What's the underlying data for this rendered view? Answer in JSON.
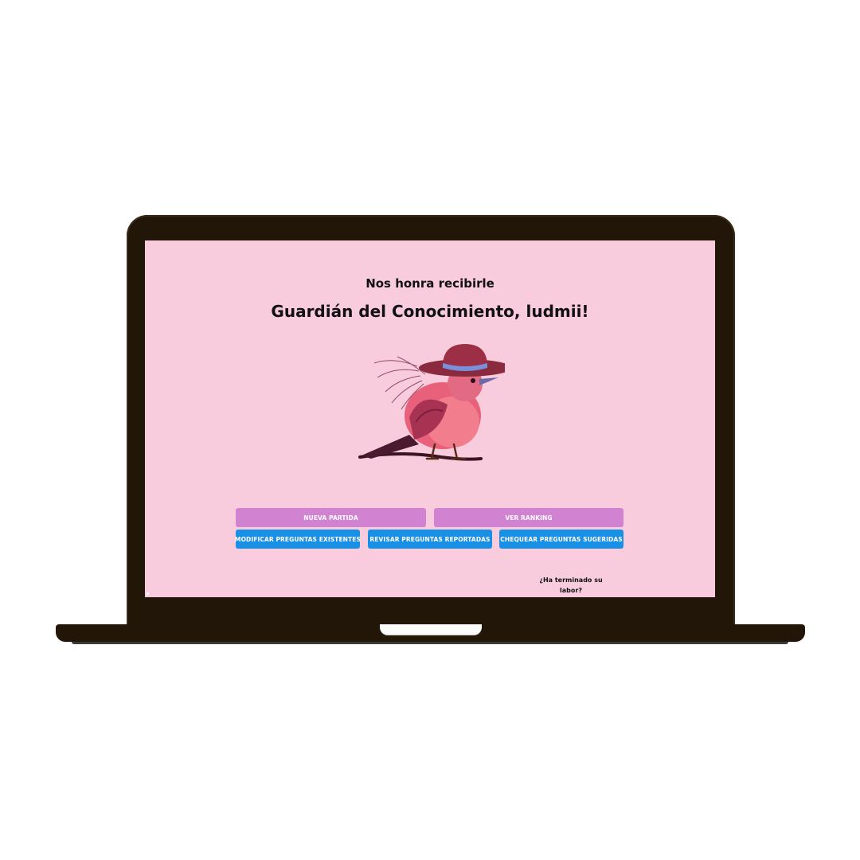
{
  "welcome": {
    "greeting": "Nos honra recibirle",
    "title": "Guardián del Conocimiento, ludmii!"
  },
  "actions": {
    "primary": [
      {
        "label": "NUEVA PARTIDA"
      },
      {
        "label": "VER RANKING"
      }
    ],
    "editor": [
      {
        "label": "MODIFICAR PREGUNTAS EXISTENTES"
      },
      {
        "label": "REVISAR PREGUNTAS REPORTADAS"
      },
      {
        "label": "CHEQUEAR PREGUNTAS SUGERIDAS"
      }
    ]
  },
  "logout": {
    "label": "¿Ha terminado su labor?"
  },
  "colors": {
    "screen_background": "#f8cbdd",
    "primary_button": "#d183d1",
    "editor_button": "#1890e6",
    "laptop_frame": "#221609"
  },
  "mascot": {
    "icon": "bird-with-hat-icon"
  }
}
